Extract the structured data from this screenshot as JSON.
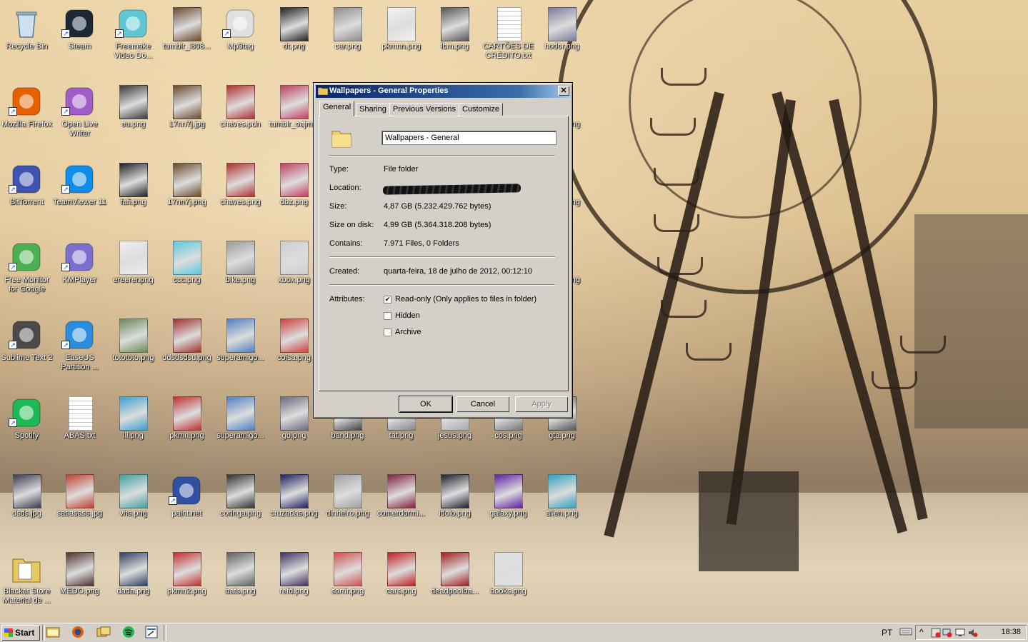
{
  "desktop": {
    "icons": [
      {
        "label": "Recycle Bin",
        "kind": "recycle",
        "shortcut": false,
        "color": "#8aa2b8"
      },
      {
        "label": "Steam",
        "kind": "app",
        "shortcut": true,
        "color": "#1b2838"
      },
      {
        "label": "Freemake Video Do...",
        "kind": "app",
        "shortcut": true,
        "color": "#5fc7d3"
      },
      {
        "label": "tumblr_l808...",
        "kind": "thumb",
        "shortcut": false,
        "color": "#6a4a2e"
      },
      {
        "label": "Mp3tag",
        "kind": "app",
        "shortcut": true,
        "color": "#e0e0e0"
      },
      {
        "label": "dt.png",
        "kind": "thumb",
        "shortcut": false,
        "color": "#222222"
      },
      {
        "label": "car.png",
        "kind": "thumb",
        "shortcut": false,
        "color": "#8d8d8d"
      },
      {
        "label": "pkmnn.png",
        "kind": "thumb",
        "shortcut": false,
        "color": "#f2f2f2"
      },
      {
        "label": "lbm.png",
        "kind": "thumb",
        "shortcut": false,
        "color": "#555555"
      },
      {
        "label": "CARTÕES DE CRÉDITO.txt",
        "kind": "txt",
        "shortcut": false,
        "color": "#ffffff"
      },
      {
        "label": "hodor.png",
        "kind": "thumb",
        "shortcut": false,
        "color": "#7b7b9c"
      },
      {
        "label": "Mozilla Firefox",
        "kind": "app",
        "shortcut": true,
        "color": "#e66000"
      },
      {
        "label": "Open Live Writer",
        "kind": "app",
        "shortcut": true,
        "color": "#a05cc8"
      },
      {
        "label": "eu.png",
        "kind": "thumb",
        "shortcut": false,
        "color": "#3a3a3a"
      },
      {
        "label": "17nn7j.jpg",
        "kind": "thumb",
        "shortcut": false,
        "color": "#6a4a2e"
      },
      {
        "label": "chaves.pdn",
        "kind": "thumb",
        "shortcut": false,
        "color": "#b03030"
      },
      {
        "label": "tumblr_oajm...",
        "kind": "thumb",
        "shortcut": false,
        "color": "#c04060"
      },
      {
        "label": "BitTorrent",
        "kind": "app",
        "shortcut": true,
        "color": "#3f53b0"
      },
      {
        "label": "TeamViewer 11",
        "kind": "app",
        "shortcut": true,
        "color": "#0e8ee9"
      },
      {
        "label": "fafi.png",
        "kind": "thumb",
        "shortcut": false,
        "color": "#222222"
      },
      {
        "label": "17nn7j.png",
        "kind": "thumb",
        "shortcut": false,
        "color": "#6a4a2e"
      },
      {
        "label": "chaves.png",
        "kind": "thumb",
        "shortcut": false,
        "color": "#b03030"
      },
      {
        "label": "dbz.png",
        "kind": "thumb",
        "shortcut": false,
        "color": "#c04060"
      },
      {
        "label": "Free Monitor for Google",
        "kind": "app",
        "shortcut": true,
        "color": "#4caf50"
      },
      {
        "label": "KMPlayer",
        "kind": "app",
        "shortcut": true,
        "color": "#7a6fd1"
      },
      {
        "label": "ereerer.png",
        "kind": "thumb",
        "shortcut": false,
        "color": "#eeeeee"
      },
      {
        "label": "ccc.png",
        "kind": "thumb",
        "shortcut": false,
        "color": "#5bc8e0"
      },
      {
        "label": "bike.png",
        "kind": "thumb",
        "shortcut": false,
        "color": "#9a9a9a"
      },
      {
        "label": "xbox.png",
        "kind": "thumb",
        "shortcut": false,
        "color": "#cfcfcf"
      },
      {
        "label": "Sublime Text 2",
        "kind": "app",
        "shortcut": true,
        "color": "#4a4a4a"
      },
      {
        "label": "EaseUS Partition ...",
        "kind": "app",
        "shortcut": true,
        "color": "#2a8ee0"
      },
      {
        "label": "totototo.png",
        "kind": "thumb",
        "shortcut": false,
        "color": "#6a8a5a"
      },
      {
        "label": "ddsdsdsd.png",
        "kind": "thumb",
        "shortcut": false,
        "color": "#a03030"
      },
      {
        "label": "superamigo...",
        "kind": "thumb",
        "shortcut": false,
        "color": "#5080c0"
      },
      {
        "label": "coisa.png",
        "kind": "thumb",
        "shortcut": false,
        "color": "#d04040"
      },
      {
        "label": "Spotify",
        "kind": "app",
        "shortcut": true,
        "color": "#1db954"
      },
      {
        "label": "ABAS.txt",
        "kind": "txt",
        "shortcut": false,
        "color": "#ffffff"
      },
      {
        "label": "lll.png",
        "kind": "thumb",
        "shortcut": false,
        "color": "#3aa0d0"
      },
      {
        "label": "pkmn.png",
        "kind": "thumb",
        "shortcut": false,
        "color": "#c03030"
      },
      {
        "label": "superamigo...",
        "kind": "thumb",
        "shortcut": false,
        "color": "#5080c0"
      },
      {
        "label": "gb.png",
        "kind": "thumb",
        "shortcut": false,
        "color": "#6a6a80"
      },
      {
        "label": "band.png",
        "kind": "thumb",
        "shortcut": false,
        "color": "#444444"
      },
      {
        "label": "tat.png",
        "kind": "thumb",
        "shortcut": false,
        "color": "#888888"
      },
      {
        "label": "jesus.png",
        "kind": "thumb",
        "shortcut": false,
        "color": "#aaaaaa"
      },
      {
        "label": "cos.png",
        "kind": "thumb",
        "shortcut": false,
        "color": "#777777"
      },
      {
        "label": "gta.png",
        "kind": "thumb",
        "shortcut": false,
        "color": "#555555"
      },
      {
        "label": "dsds.jpg",
        "kind": "thumb",
        "shortcut": false,
        "color": "#3a3a50"
      },
      {
        "label": "sasasass.jpg",
        "kind": "thumb",
        "shortcut": false,
        "color": "#c04030"
      },
      {
        "label": "vhs.png",
        "kind": "thumb",
        "shortcut": false,
        "color": "#40a0a0"
      },
      {
        "label": "paint.net",
        "kind": "app",
        "shortcut": true,
        "color": "#3050a0"
      },
      {
        "label": "coringa.png",
        "kind": "thumb",
        "shortcut": false,
        "color": "#303030"
      },
      {
        "label": "cruzadas.png",
        "kind": "thumb",
        "shortcut": false,
        "color": "#202060"
      },
      {
        "label": "dinheiro.png",
        "kind": "thumb",
        "shortcut": false,
        "color": "#a0a0a0"
      },
      {
        "label": "comerdormi...",
        "kind": "thumb",
        "shortcut": false,
        "color": "#802040"
      },
      {
        "label": "idolo.png",
        "kind": "thumb",
        "shortcut": false,
        "color": "#202030"
      },
      {
        "label": "galaxy.png",
        "kind": "thumb",
        "shortcut": false,
        "color": "#6020a0"
      },
      {
        "label": "alien.png",
        "kind": "thumb",
        "shortcut": false,
        "color": "#30a0c0"
      },
      {
        "label": "Blackat Store Material de ...",
        "kind": "folder",
        "shortcut": false,
        "color": "#e8c860"
      },
      {
        "label": "MEDO.png",
        "kind": "thumb",
        "shortcut": false,
        "color": "#503030"
      },
      {
        "label": "dada.png",
        "kind": "thumb",
        "shortcut": false,
        "color": "#304060"
      },
      {
        "label": "pkmn2.png",
        "kind": "thumb",
        "shortcut": false,
        "color": "#c03030"
      },
      {
        "label": "bats.png",
        "kind": "thumb",
        "shortcut": false,
        "color": "#606060"
      },
      {
        "label": "refd.png",
        "kind": "thumb",
        "shortcut": false,
        "color": "#403060"
      },
      {
        "label": "sorrir.png",
        "kind": "thumb",
        "shortcut": false,
        "color": "#d05050"
      },
      {
        "label": "cars.png",
        "kind": "thumb",
        "shortcut": false,
        "color": "#c02020"
      },
      {
        "label": "deadpoolba...",
        "kind": "thumb",
        "shortcut": false,
        "color": "#a02020"
      },
      {
        "label": "books.png",
        "kind": "thumb",
        "shortcut": false,
        "color": "#e0e0e0"
      }
    ],
    "partial_labels": [
      "ng",
      "ng",
      "ng"
    ]
  },
  "dialog": {
    "title": "Wallpapers - General Properties",
    "close": "✕",
    "tabs": [
      "General",
      "Sharing",
      "Previous Versions",
      "Customize"
    ],
    "name_value": "Wallpapers - General",
    "rows": [
      {
        "label": "Type:",
        "value": "File folder"
      },
      {
        "label": "Location:",
        "value": ""
      },
      {
        "label": "Size:",
        "value": "4,87 GB (5.232.429.762 bytes)"
      },
      {
        "label": "Size on disk:",
        "value": "4,99 GB (5.364.318.208 bytes)"
      },
      {
        "label": "Contains:",
        "value": "7.971 Files, 0 Folders"
      },
      {
        "label": "Created:",
        "value": "quarta-feira, 18 de julho de 2012, 00:12:10"
      }
    ],
    "attributes_label": "Attributes:",
    "checkboxes": [
      {
        "label": "Read-only (Only applies to files in folder)",
        "checked": true
      },
      {
        "label": "Hidden",
        "checked": false
      },
      {
        "label": "Archive",
        "checked": false
      }
    ],
    "buttons": {
      "ok": "OK",
      "cancel": "Cancel",
      "apply": "Apply"
    }
  },
  "taskbar": {
    "start": "Start",
    "quick_launch": [
      "explorer-icon",
      "firefox-icon",
      "folders-icon",
      "spotify-icon",
      "properties-icon"
    ],
    "language": "PT",
    "clock": "18:38"
  }
}
